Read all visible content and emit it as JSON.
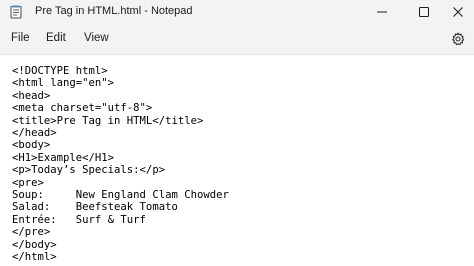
{
  "window": {
    "title": "Pre Tag in HTML.html - Notepad",
    "app_icon": "notepad-icon",
    "controls": [
      "minimize-icon",
      "maximize-icon",
      "close-icon"
    ]
  },
  "menu": {
    "items": [
      "File",
      "Edit",
      "View"
    ],
    "settings_icon": "gear-icon"
  },
  "editor": {
    "lines": [
      "<!DOCTYPE html>",
      "<html lang=\"en\">",
      "<head>",
      "<meta charset=\"utf-8\">",
      "<title>Pre Tag in HTML</title>",
      "</head>",
      "<body>",
      "<H1>Example</H1>",
      "<p>Today’s Specials:</p>",
      "<pre>",
      "Soup:     New England Clam Chowder",
      "Salad:    Beefsteak Tomato",
      "Entrée:   Surf & Turf",
      "</pre>",
      "</body>",
      "</html>"
    ]
  }
}
